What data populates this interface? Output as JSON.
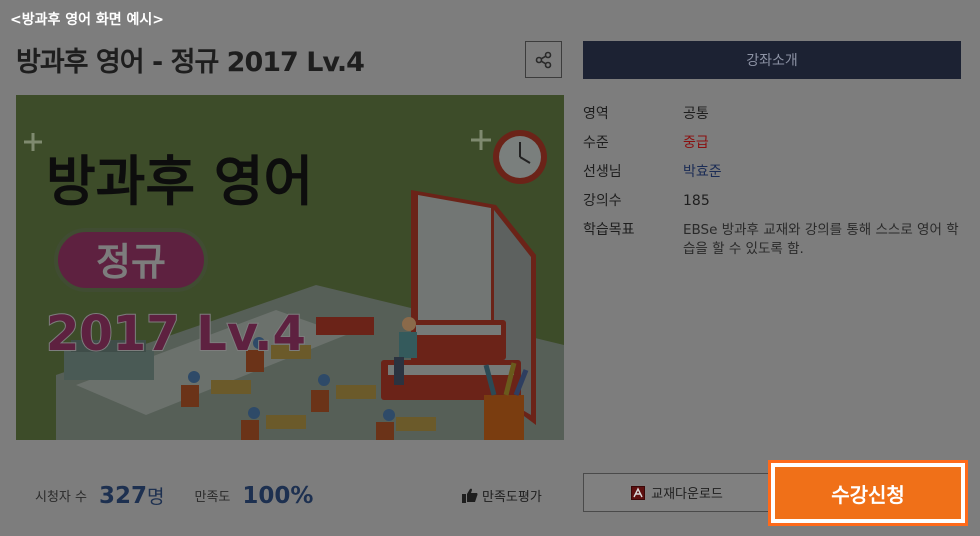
{
  "caption": "<방과후 영어 화면 예시>",
  "course": {
    "title": "방과후 영어 - 정규 2017 Lv.4"
  },
  "thumbnail": {
    "title_line1": "방과후 영어",
    "badge": "정규",
    "subtitle": "2017 Lv.4"
  },
  "tabs": {
    "intro": "강좌소개"
  },
  "info": [
    {
      "key": "영역",
      "value": "공통"
    },
    {
      "key": "수준",
      "value": "중급"
    },
    {
      "key": "선생님",
      "value": "박효준"
    },
    {
      "key": "강의수",
      "value": "185"
    },
    {
      "key": "학습목표",
      "value": "EBSe 방과후 교재와 강의를 통해 스스로 영어 학습을 할 수 있도록 함."
    }
  ],
  "stats": {
    "viewers_label": "시청자 수",
    "viewers_value": "327",
    "viewers_unit": "명",
    "satisfaction_label": "만족도",
    "satisfaction_value": "100%"
  },
  "buttons": {
    "rate": "만족도평가",
    "download": "교재다운로드",
    "apply": "수강신청"
  },
  "colors": {
    "apply": "#f07018",
    "apply_border": "#ff6a1a",
    "tab_bg": "#1c2233"
  },
  "icons": {
    "share": "share-icon",
    "thumb": "thumbs-up-icon",
    "pdf": "pdf-icon"
  }
}
